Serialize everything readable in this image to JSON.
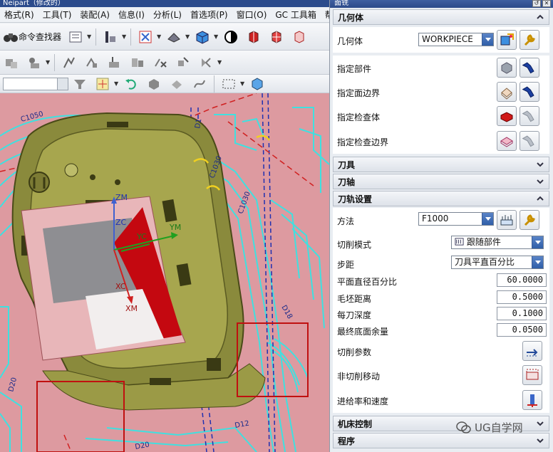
{
  "nx_window": {
    "title": "Neipart（修改的）",
    "menu": [
      "格式(R)",
      "工具(T)",
      "装配(A)",
      "信息(I)",
      "分析(L)",
      "首选项(P)",
      "窗口(O)",
      "GC 工具箱",
      "帮"
    ],
    "toolbar": {
      "command_finder_label": "命令查找器"
    }
  },
  "viewport": {
    "labels": {
      "zm": "ZM",
      "zc": "ZC",
      "yc": "YC",
      "ym": "YM",
      "xc": "XC",
      "xm": "XM",
      "path1": "C1050",
      "path2": "C1030",
      "path3": "C1030",
      "path4": "D1",
      "path5": "D20",
      "path6": "D18",
      "path7": "D20",
      "path8": "D12"
    }
  },
  "dialog": {
    "title": "面铣",
    "geometry_section": {
      "header": "几何体",
      "rows": [
        {
          "label": "几何体",
          "value": "WORKPIECE"
        },
        {
          "label": "指定部件"
        },
        {
          "label": "指定面边界"
        },
        {
          "label": "指定检查体"
        },
        {
          "label": "指定检查边界"
        }
      ]
    },
    "tool_section": {
      "header": "刀具"
    },
    "axis_section": {
      "header": "刀轴"
    },
    "toolpath_section": {
      "header": "刀轨设置",
      "method_label": "方法",
      "method_value": "F1000",
      "cut_pattern_label": "切削模式",
      "cut_pattern_value": "跟随部件",
      "stepover_label": "步距",
      "stepover_value": "刀具平直百分比",
      "flat_percent_label": "平面直径百分比",
      "flat_percent_value": "60.0000",
      "blank_distance_label": "毛坯距离",
      "blank_distance_value": "0.5000",
      "depth_per_cut_label": "每刀深度",
      "depth_per_cut_value": "0.1000",
      "final_floor_stock_label": "最终底面余量",
      "final_floor_stock_value": "0.0500",
      "cutting_params_label": "切削参数",
      "non_cutting_label": "非切削移动",
      "feeds_speeds_label": "进给率和速度"
    },
    "machine_control_section": {
      "header": "机床控制"
    },
    "program_section": {
      "header": "程序"
    }
  },
  "watermark": {
    "text": "UG自学网"
  },
  "colors": {
    "accent": "#2f5ea8",
    "viewport_bg": "#dd9aa0",
    "toolpath_cyan": "#3fe0e0",
    "part_olive": "#8a8a3c",
    "axis_red": "#c2141a"
  }
}
